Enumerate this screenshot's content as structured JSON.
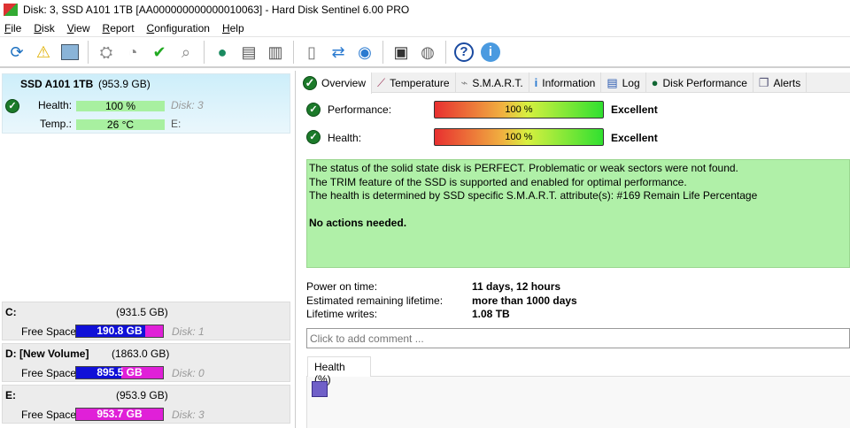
{
  "window": {
    "title": "Disk: 3, SSD A101 1TB [AA000000000000010063]  -  Hard Disk Sentinel 6.00 PRO"
  },
  "menu": [
    "File",
    "Disk",
    "View",
    "Report",
    "Configuration",
    "Help"
  ],
  "toolbar": [
    "refresh-icon",
    "alert-icon",
    "disk-icon",
    "disk-settings-icon",
    "disk-timer-icon",
    "disk-check-icon",
    "disk-search-icon",
    "internet-icon",
    "disk-copy-icon",
    "disk-print-icon",
    "report-icon",
    "sync-icon",
    "network-icon",
    "monitor-icon",
    "sound-icon",
    "help-icon",
    "info-icon"
  ],
  "disk": {
    "name": "SSD A101 1TB",
    "size": "(953.9 GB)",
    "health_label": "Health:",
    "health": "100 %",
    "temp_label": "Temp.:",
    "temp": "26 °C",
    "disk_no": "Disk: 3",
    "drive": "E:"
  },
  "volumes": [
    {
      "name": "C:",
      "size": "(931.5 GB)",
      "label": "Free Space",
      "free": "190.8 GB",
      "disk": "Disk: 1",
      "used_fraction": 0.795
    },
    {
      "name": "D: [New Volume]",
      "size": "(1863.0 GB)",
      "label": "Free Space",
      "free": "895.5 GB",
      "disk": "Disk: 0",
      "used_fraction": 0.52
    },
    {
      "name": "E:",
      "size": "(953.9 GB)",
      "label": "Free Space",
      "free": "953.7 GB",
      "disk": "Disk: 3",
      "used_fraction": 0.0
    }
  ],
  "tabs": [
    "Overview",
    "Temperature",
    "S.M.A.R.T.",
    "Information",
    "Log",
    "Disk Performance",
    "Alerts"
  ],
  "overview": {
    "performance_label": "Performance:",
    "performance": "100 %",
    "performance_rating": "Excellent",
    "health_label": "Health:",
    "health": "100 %",
    "health_rating": "Excellent",
    "status": [
      "The status of the solid state disk is PERFECT. Problematic or weak sectors were not found.",
      "The TRIM feature of the SSD is supported and enabled for optimal performance.",
      "The health is determined by SSD specific S.M.A.R.T. attribute(s):  #169 Remain Life Percentage"
    ],
    "action": "No actions needed.",
    "power_on_label": "Power on time:",
    "power_on": "11 days, 12 hours",
    "remaining_label": "Estimated remaining lifetime:",
    "remaining": "more than 1000 days",
    "writes_label": "Lifetime writes:",
    "writes": "1.08 TB",
    "comment_placeholder": "Click to add comment ...",
    "health_tab": "Health (%)"
  }
}
